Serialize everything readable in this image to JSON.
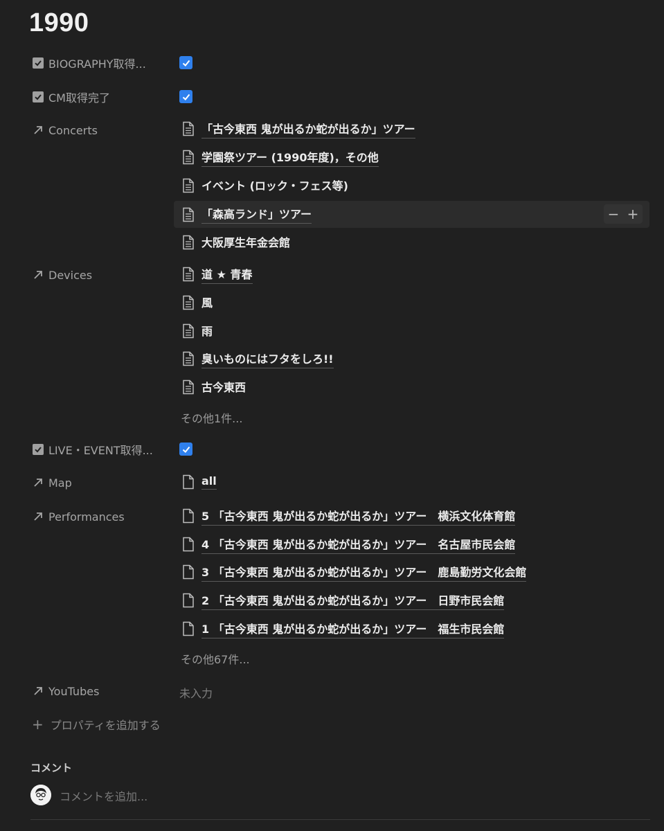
{
  "page": {
    "title": "1990"
  },
  "properties": {
    "biography": {
      "name": "BIOGRAPHY取得...",
      "checked": true
    },
    "cm": {
      "name": "CM取得完了",
      "checked": true
    },
    "concerts": {
      "name": "Concerts",
      "items": [
        "「古今東西 鬼が出るか蛇が出るか」ツアー",
        "学園祭ツアー (1990年度)，その他",
        "イベント (ロック・フェス等)",
        "「森高ランド」ツアー",
        "大阪厚生年金会館"
      ]
    },
    "devices": {
      "name": "Devices",
      "items": [
        "道 ★ 青春",
        "風",
        "雨",
        "臭いものにはフタをしろ!!",
        "古今東西"
      ],
      "more": "その他1件..."
    },
    "live_event": {
      "name": "LIVE・EVENT取得...",
      "checked": true
    },
    "map": {
      "name": "Map",
      "items": [
        "all"
      ]
    },
    "performances": {
      "name": "Performances",
      "items": [
        "5 「古今東西 鬼が出るか蛇が出るか」ツアー　横浜文化体育館",
        "4 「古今東西 鬼が出るか蛇が出るか」ツアー　名古屋市民会館",
        "3 「古今東西 鬼が出るか蛇が出るか」ツアー　鹿島勤労文化会館",
        "2 「古今東西 鬼が出るか蛇が出るか」ツアー　日野市民会館",
        "1 「古今東西 鬼が出るか蛇が出るか」ツアー　福生市民会館"
      ],
      "more": "その他67件..."
    },
    "youtubes": {
      "name": "YouTubes",
      "empty": "未入力"
    }
  },
  "hover_controls": {
    "minus": "−",
    "plus": "+"
  },
  "add_property": {
    "label": "プロパティを追加する"
  },
  "comments": {
    "heading": "コメント",
    "placeholder": "コメントを追加..."
  },
  "colors": {
    "checkbox_blue": "#2f80ed",
    "background": "#202020"
  }
}
